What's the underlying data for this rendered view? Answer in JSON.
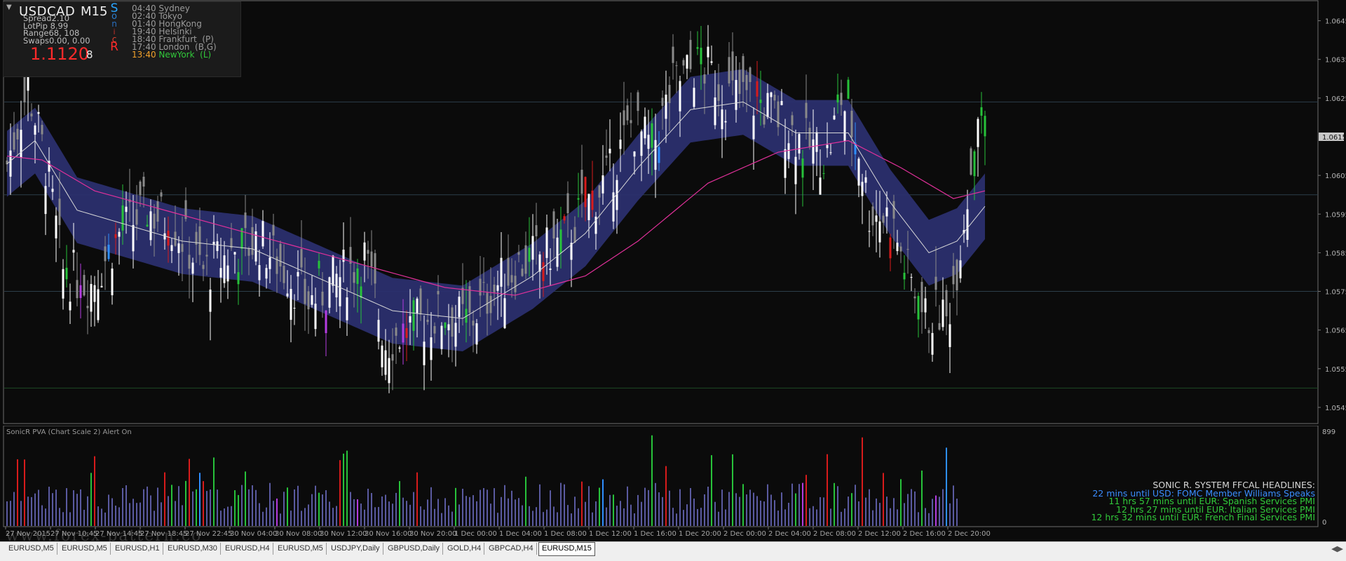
{
  "info": {
    "collapse_icon": "triangle-down",
    "symbol": "USDCAD",
    "timeframe": "M15",
    "spread": "Spread2.10",
    "lotpip": "LotPip 8.99",
    "range": "Range68, 108",
    "swaps": "Swaps0.00, 0.00",
    "price": "1.1120",
    "count": "8",
    "sonic_letters": [
      {
        "t": "S",
        "color": "#2aa5ff",
        "size": 17
      },
      {
        "t": "o",
        "color": "#2a7fd0",
        "size": 13
      },
      {
        "t": "n",
        "color": "#2a6fc0",
        "size": 12
      },
      {
        "t": "i",
        "color": "#c0302a",
        "size": 11
      },
      {
        "t": "c",
        "color": "#e04030",
        "size": 12
      },
      {
        "t": "R",
        "color": "#ff2a2a",
        "size": 17
      }
    ],
    "sessions": [
      {
        "time": "04:40",
        "city": "Sydney",
        "color": "#9a9a9a"
      },
      {
        "time": "02:40",
        "city": "Tokyo",
        "color": "#9a9a9a"
      },
      {
        "time": "01:40",
        "city": "HongKong",
        "color": "#9a9a9a"
      },
      {
        "time": "19:40",
        "city": "Helsinki",
        "color": "#9a9a9a"
      },
      {
        "time": "18:40",
        "city": "Frankfurt  (P)",
        "color": "#9a9a9a"
      },
      {
        "time": "17:40",
        "city": "London  (B,G)",
        "color": "#9a9a9a"
      },
      {
        "time": "13:40",
        "city": "NewYork  (L)",
        "color": "#31c93a",
        "time_color": "#f2a12a"
      }
    ]
  },
  "colors": {
    "background": "#0b0b0b",
    "grid_line": "#2c3e4a",
    "bull_candle": "#ffffff",
    "bear_candle": "#8a8a8a",
    "band": "#2b2f6e",
    "ema_fast": "#d8d8d8",
    "ema_slow": "#e0309a",
    "price_label_bg": "#c8c8c8",
    "volume_default": "#5a5aa0",
    "volume_green": "#27c23a",
    "volume_red": "#d81b1b",
    "volume_blue": "#2e8fff",
    "volume_magenta": "#b43ce0"
  },
  "chart_data": [
    {
      "type": "candlestick",
      "title": "",
      "ylim": [
        1.0541,
        1.065
      ],
      "y_ticks": [
        "1.0645",
        "1.0635",
        "1.0625",
        "1.0605",
        "1.0595",
        "1.0585",
        "1.0575",
        "1.0565",
        "1.0555",
        "1.0545"
      ],
      "current_price_label": "1.0615",
      "current_price": 1.0615,
      "horizontal_levels": [
        1.0624,
        1.06,
        1.0575,
        1.055
      ],
      "x_labels": [
        "27 Nov 2015",
        "27 Nov 10:45",
        "27 Nov 14:45",
        "27 Nov 18:45",
        "27 Nov 22:45",
        "30 Nov 04:00",
        "30 Nov 08:00",
        "30 Nov 12:00",
        "30 Nov 16:00",
        "30 Nov 20:00",
        "1 Dec 00:00",
        "1 Dec 04:00",
        "1 Dec 08:00",
        "1 Dec 12:00",
        "1 Dec 16:00",
        "1 Dec 20:00",
        "2 Dec 00:00",
        "2 Dec 04:00",
        "2 Dec 08:00",
        "2 Dec 12:00",
        "2 Dec 16:00",
        "2 Dec 20:00"
      ],
      "bars_count": 268,
      "close_keypoints": [
        {
          "bar": 0,
          "close": 1.0608
        },
        {
          "bar": 6,
          "close": 1.0628
        },
        {
          "bar": 11,
          "close": 1.0608
        },
        {
          "bar": 16,
          "close": 1.058
        },
        {
          "bar": 24,
          "close": 1.0577
        },
        {
          "bar": 32,
          "close": 1.059
        },
        {
          "bar": 40,
          "close": 1.0596
        },
        {
          "bar": 48,
          "close": 1.0592
        },
        {
          "bar": 56,
          "close": 1.058
        },
        {
          "bar": 64,
          "close": 1.0585
        },
        {
          "bar": 72,
          "close": 1.0588
        },
        {
          "bar": 80,
          "close": 1.058
        },
        {
          "bar": 86,
          "close": 1.0572
        },
        {
          "bar": 94,
          "close": 1.0578
        },
        {
          "bar": 102,
          "close": 1.0584
        },
        {
          "bar": 108,
          "close": 1.0562
        },
        {
          "bar": 116,
          "close": 1.0566
        },
        {
          "bar": 124,
          "close": 1.0569
        },
        {
          "bar": 132,
          "close": 1.0567
        },
        {
          "bar": 138,
          "close": 1.0575
        },
        {
          "bar": 146,
          "close": 1.0582
        },
        {
          "bar": 154,
          "close": 1.0585
        },
        {
          "bar": 160,
          "close": 1.059
        },
        {
          "bar": 166,
          "close": 1.0598
        },
        {
          "bar": 172,
          "close": 1.0605
        },
        {
          "bar": 178,
          "close": 1.0618
        },
        {
          "bar": 184,
          "close": 1.0612
        },
        {
          "bar": 190,
          "close": 1.0628
        },
        {
          "bar": 196,
          "close": 1.0633
        },
        {
          "bar": 200,
          "close": 1.0632
        },
        {
          "bar": 205,
          "close": 1.0626
        },
        {
          "bar": 212,
          "close": 1.0625
        },
        {
          "bar": 220,
          "close": 1.062
        },
        {
          "bar": 228,
          "close": 1.0613
        },
        {
          "bar": 234,
          "close": 1.061
        },
        {
          "bar": 238,
          "close": 1.0625
        },
        {
          "bar": 243,
          "close": 1.0612
        },
        {
          "bar": 246,
          "close": 1.0596
        },
        {
          "bar": 252,
          "close": 1.0594
        },
        {
          "bar": 256,
          "close": 1.0582
        },
        {
          "bar": 262,
          "close": 1.0568
        },
        {
          "bar": 266,
          "close": 1.057
        },
        {
          "bar": 268,
          "close": 1.0567
        },
        {
          "bar": 271,
          "close": 1.0582
        },
        {
          "bar": 274,
          "close": 1.06
        },
        {
          "bar": 277,
          "close": 1.0622
        },
        {
          "bar": 279,
          "close": 1.0615
        }
      ],
      "ema_fast_keypoints": [
        {
          "bar": 0,
          "v": 1.0608
        },
        {
          "bar": 8,
          "v": 1.0614
        },
        {
          "bar": 20,
          "v": 1.0596
        },
        {
          "bar": 35,
          "v": 1.0592
        },
        {
          "bar": 50,
          "v": 1.0588
        },
        {
          "bar": 70,
          "v": 1.0586
        },
        {
          "bar": 90,
          "v": 1.0578
        },
        {
          "bar": 110,
          "v": 1.057
        },
        {
          "bar": 130,
          "v": 1.0568
        },
        {
          "bar": 150,
          "v": 1.0579
        },
        {
          "bar": 165,
          "v": 1.059
        },
        {
          "bar": 180,
          "v": 1.0607
        },
        {
          "bar": 195,
          "v": 1.0622
        },
        {
          "bar": 210,
          "v": 1.0624
        },
        {
          "bar": 225,
          "v": 1.0616
        },
        {
          "bar": 240,
          "v": 1.0616
        },
        {
          "bar": 252,
          "v": 1.0598
        },
        {
          "bar": 263,
          "v": 1.0585
        },
        {
          "bar": 271,
          "v": 1.0588
        },
        {
          "bar": 279,
          "v": 1.0597
        }
      ],
      "ema_slow_keypoints": [
        {
          "bar": 0,
          "v": 1.061
        },
        {
          "bar": 10,
          "v": 1.0609
        },
        {
          "bar": 25,
          "v": 1.0601
        },
        {
          "bar": 45,
          "v": 1.0596
        },
        {
          "bar": 65,
          "v": 1.0591
        },
        {
          "bar": 85,
          "v": 1.0586
        },
        {
          "bar": 105,
          "v": 1.0581
        },
        {
          "bar": 125,
          "v": 1.0576
        },
        {
          "bar": 145,
          "v": 1.0574
        },
        {
          "bar": 165,
          "v": 1.0579
        },
        {
          "bar": 180,
          "v": 1.0588
        },
        {
          "bar": 200,
          "v": 1.0603
        },
        {
          "bar": 220,
          "v": 1.0611
        },
        {
          "bar": 240,
          "v": 1.0614
        },
        {
          "bar": 255,
          "v": 1.0607
        },
        {
          "bar": 270,
          "v": 1.0599
        },
        {
          "bar": 279,
          "v": 1.0601
        }
      ],
      "band_half_width": 0.00085
    },
    {
      "type": "bar",
      "title": "SonicR PVA  (Chart Scale 2)   Alert On",
      "ylim": [
        0,
        899
      ],
      "y_ticks": [
        "899",
        "0"
      ],
      "bars_count": 268
    }
  ],
  "headlines": [
    {
      "text": "SONIC R. SYSTEM  FFCAL HEADLINES:",
      "color": "#d8d8d8"
    },
    {
      "text": "22 mins until USD: FOMC Member Williams Speaks",
      "color": "#3a8dff"
    },
    {
      "text": "11 hrs 57 mins until EUR: Spanish Services PMI",
      "color": "#31c93a"
    },
    {
      "text": "12 hrs 27 mins until EUR: Italian Services PMI",
      "color": "#31c93a"
    },
    {
      "text": "12 hrs 32 mins until EUR: French Final Services PMI",
      "color": "#31c93a"
    }
  ],
  "watermark": "www.forex-pattern.co",
  "tabs": [
    {
      "label": "EURUSD,M5",
      "active": false
    },
    {
      "label": "EURUSD,M5",
      "active": false
    },
    {
      "label": "EURUSD,H1",
      "active": false
    },
    {
      "label": "EURUSD,M30",
      "active": false
    },
    {
      "label": "EURUSD,H4",
      "active": false
    },
    {
      "label": "EURUSD,M5",
      "active": false
    },
    {
      "label": "USDJPY,Daily",
      "active": false
    },
    {
      "label": "GBPUSD,Daily",
      "active": false
    },
    {
      "label": "GOLD,H4",
      "active": false
    },
    {
      "label": "GBPCAD,H4",
      "active": false
    },
    {
      "label": "EURUSD,M15",
      "active": true
    }
  ],
  "tab_scroll_icon": "scroll-arrows"
}
